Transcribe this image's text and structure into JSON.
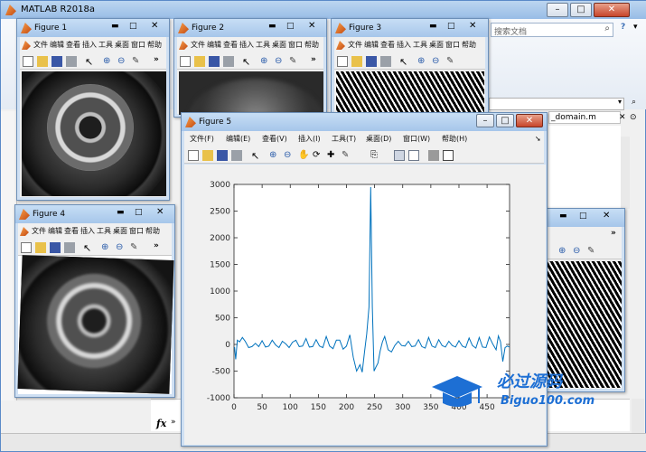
{
  "main": {
    "title": "MATLAB R2018a",
    "search_placeholder": "搜索文档",
    "file_tab": "_domain.m",
    "fx_label": "fx",
    "fx_prompt": "»"
  },
  "fig1": {
    "title": "Figure 1",
    "menu": [
      "文件",
      "编辑",
      "查看",
      "插入",
      "工具",
      "桌面",
      "窗口",
      "帮助"
    ],
    "more": "»"
  },
  "fig2": {
    "title": "Figure 2",
    "menu": [
      "文件",
      "编辑",
      "查看",
      "插入",
      "工具",
      "桌面",
      "窗口",
      "帮助"
    ],
    "more": "»"
  },
  "fig3": {
    "title": "Figure 3",
    "menu": [
      "文件",
      "编辑",
      "查看",
      "插入",
      "工具",
      "桌面",
      "窗口",
      "帮助"
    ],
    "more": "»"
  },
  "fig4": {
    "title": "Figure 4",
    "menu": [
      "文件",
      "编辑",
      "查看",
      "插入",
      "工具",
      "桌面",
      "窗口",
      "帮助"
    ],
    "more": "»"
  },
  "fig6": {
    "more": "»"
  },
  "fig5": {
    "title": "Figure 5",
    "menu": [
      "文件(F)",
      "编辑(E)",
      "查看(V)",
      "插入(I)",
      "工具(T)",
      "桌面(D)",
      "窗口(W)",
      "帮助(H)"
    ]
  },
  "chart_data": {
    "type": "line",
    "xlim": [
      0,
      490
    ],
    "ylim": [
      -1000,
      3000
    ],
    "xticks": [
      0,
      50,
      100,
      150,
      200,
      250,
      300,
      350,
      400,
      450
    ],
    "yticks": [
      -1000,
      -500,
      0,
      500,
      1000,
      1500,
      2000,
      2500,
      3000
    ],
    "series": [
      {
        "color": "#0072bd",
        "x": [
          1,
          3,
          6,
          10,
          15,
          20,
          26,
          32,
          38,
          44,
          50,
          56,
          62,
          68,
          74,
          80,
          86,
          92,
          98,
          104,
          110,
          116,
          122,
          128,
          134,
          140,
          146,
          152,
          158,
          164,
          170,
          176,
          182,
          188,
          194,
          200,
          206,
          212,
          218,
          224,
          228,
          232,
          236,
          240,
          243,
          246,
          249,
          252,
          256,
          260,
          264,
          268,
          274,
          280,
          286,
          292,
          298,
          304,
          310,
          316,
          322,
          328,
          334,
          340,
          346,
          352,
          358,
          364,
          370,
          376,
          382,
          388,
          394,
          400,
          406,
          412,
          418,
          424,
          430,
          436,
          442,
          448,
          454,
          460,
          466,
          470,
          474,
          478,
          482,
          486,
          490
        ],
        "y": [
          -50,
          -280,
          80,
          50,
          130,
          60,
          -60,
          -40,
          20,
          -40,
          70,
          -50,
          -30,
          80,
          -10,
          -60,
          60,
          10,
          -60,
          40,
          80,
          -40,
          -30,
          110,
          -50,
          -40,
          90,
          -30,
          -60,
          150,
          -30,
          -80,
          80,
          80,
          -90,
          -30,
          180,
          -240,
          -500,
          -380,
          -520,
          -150,
          200,
          700,
          2950,
          700,
          -500,
          -430,
          -350,
          -120,
          50,
          150,
          -100,
          -140,
          -20,
          60,
          -20,
          -30,
          60,
          -40,
          -30,
          90,
          -40,
          -70,
          130,
          -30,
          -60,
          90,
          -20,
          -50,
          60,
          -20,
          -50,
          70,
          -30,
          -60,
          120,
          -20,
          -70,
          130,
          -50,
          -60,
          140,
          10,
          -100,
          160,
          50,
          -320,
          -60,
          -30,
          -50
        ]
      }
    ]
  },
  "watermark": {
    "title": "必过源码",
    "url": "Biguo100.com"
  }
}
